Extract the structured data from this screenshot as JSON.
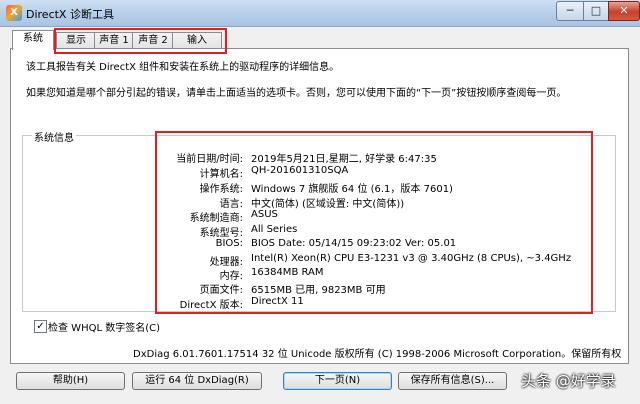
{
  "window": {
    "title": "DirectX 诊断工具",
    "controls": [
      "─",
      "□",
      "✕"
    ]
  },
  "tabs": [
    "系统",
    "显示",
    "声音 1",
    "声音 2",
    "输入"
  ],
  "description": {
    "line1": "该工具报告有关 DirectX 组件和安装在系统上的驱动程序的详细信息。",
    "line2": "如果您知道是哪个部分引起的错误，请单击上面适当的选项卡。否则，您可以使用下面的“下一页”按钮按顺序查阅每一页。"
  },
  "system_info": {
    "group_label": "系统信息",
    "rows": [
      {
        "label": "当前日期/时间:",
        "value": "2019年5月21日,星期二, 好学录 6:47:35"
      },
      {
        "label": "计算机名:",
        "value": "QH-201601310SQA"
      },
      {
        "label": "操作系统:",
        "value": "Windows 7 旗舰版 64 位 (6.1，版本 7601)"
      },
      {
        "label": "语言:",
        "value": "中文(简体) (区域设置: 中文(简体))"
      },
      {
        "label": "系统制造商:",
        "value": "ASUS"
      },
      {
        "label": "系统型号:",
        "value": "All Series"
      },
      {
        "label": "BIOS:",
        "value": "BIOS Date: 05/14/15 09:23:02 Ver: 05.01"
      },
      {
        "label": "处理器:",
        "value": "Intel(R) Xeon(R) CPU E3-1231 v3 @ 3.40GHz (8 CPUs), ~3.4GHz"
      },
      {
        "label": "内存:",
        "value": "16384MB RAM"
      },
      {
        "label": "页面文件:",
        "value": "6515MB 已用, 9823MB 可用"
      },
      {
        "label": "DirectX 版本:",
        "value": "DirectX 11"
      }
    ]
  },
  "whql_checkbox": {
    "label": "检查 WHQL 数字签名(C)",
    "checked_mark": "✓"
  },
  "copyright": "DxDiag 6.01.7601.17514 32 位 Unicode 版权所有 (C) 1998-2006 Microsoft Corporation。保留所有权",
  "buttons": {
    "help": "帮助(H)",
    "run64": "运行 64 位 DxDiag(R)",
    "next": "下一页(N)",
    "save": "保存所有信息(S)..."
  },
  "watermark": "头条 @好学录",
  "colors": {
    "highlight": "#e02020"
  }
}
